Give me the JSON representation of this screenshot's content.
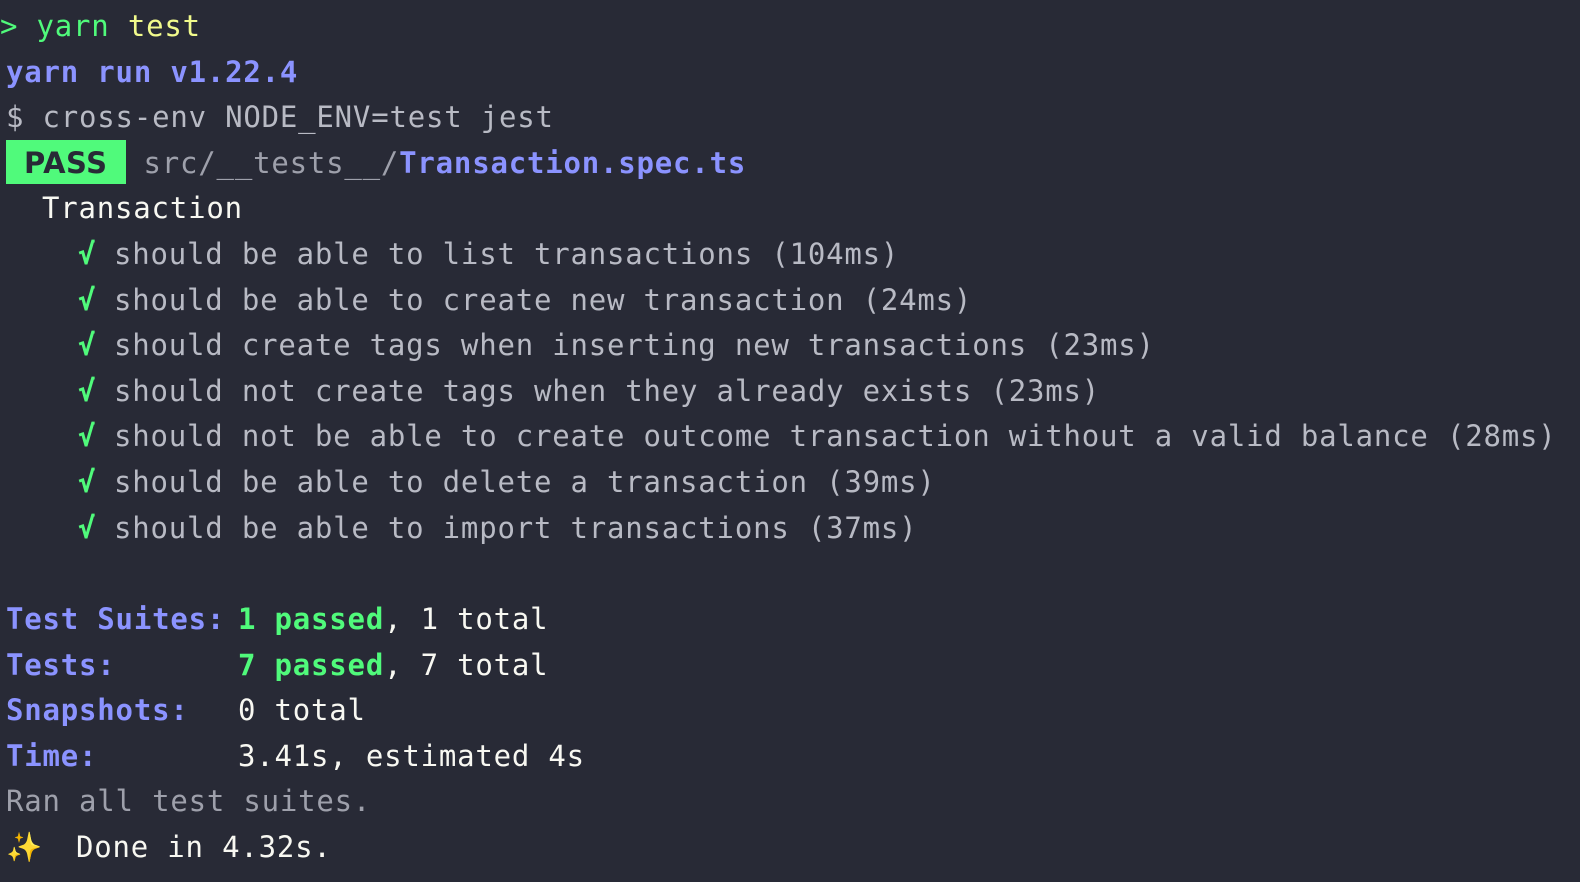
{
  "command": {
    "prompt": "> ",
    "cmd": "yarn",
    "arg": "test"
  },
  "yarn_version": "yarn run v1.22.4",
  "script_line": "$ cross-env NODE_ENV=test jest",
  "result": {
    "badge": "PASS",
    "path_prefix": "src/__tests__/",
    "filename": "Transaction.spec.ts"
  },
  "suite_name": "Transaction",
  "check_mark": "√",
  "tests": [
    {
      "label": "should be able to list transactions (104ms)"
    },
    {
      "label": "should be able to create new transaction (24ms)"
    },
    {
      "label": "should create tags when inserting new transactions (23ms)"
    },
    {
      "label": "should not create tags when they already exists (23ms)"
    },
    {
      "label": "should not be able to create outcome transaction without a valid balance (28ms)"
    },
    {
      "label": "should be able to delete a transaction (39ms)"
    },
    {
      "label": "should be able to import transactions (37ms)"
    }
  ],
  "summary": {
    "suites_label": "Test Suites:",
    "suites_passed": "1 passed",
    "suites_total": ", 1 total",
    "tests_label": "Tests:",
    "tests_passed": "7 passed",
    "tests_total": ", 7 total",
    "snapshots_label": "Snapshots:",
    "snapshots_value": "0 total",
    "time_label": "Time:",
    "time_value": "3.41s, estimated 4s"
  },
  "ran_all": "Ran all test suites.",
  "done": {
    "icon": "✨",
    "text": "Done in 4.32s."
  },
  "colors": {
    "background": "#282a36",
    "accent_purple": "#8b93ff",
    "pass_green": "#50fa7b",
    "yellow": "#f1fa8c"
  }
}
